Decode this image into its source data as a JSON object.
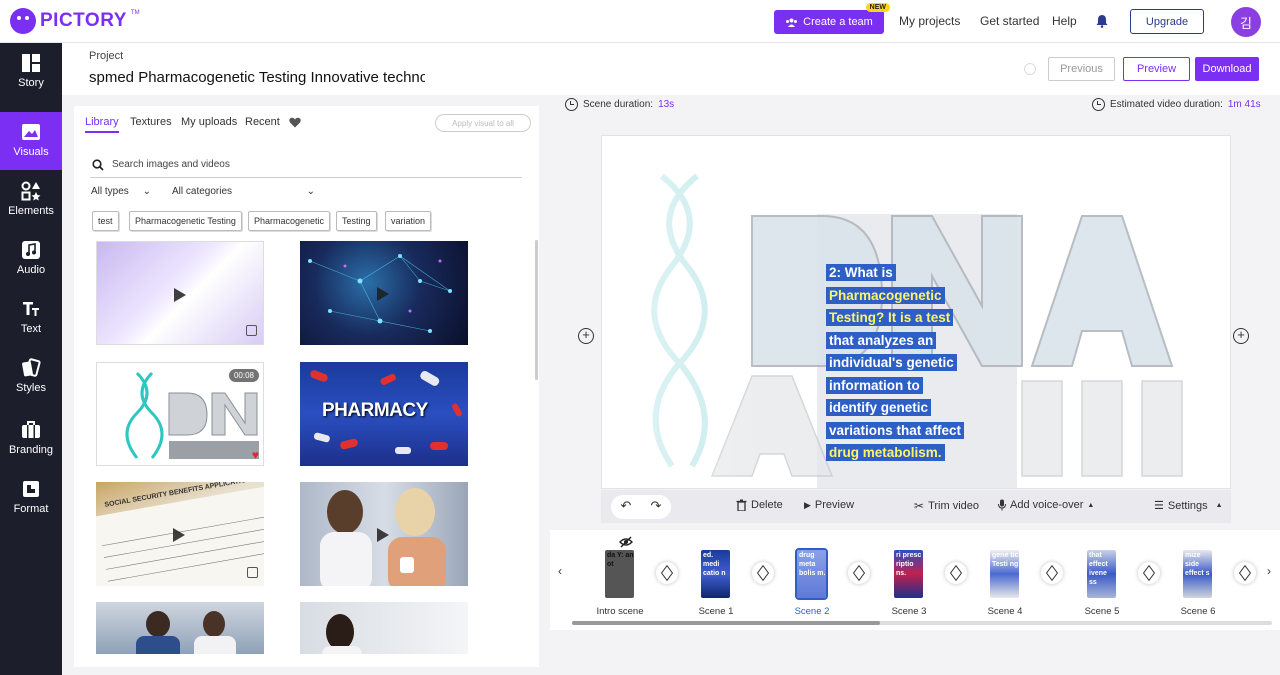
{
  "brand": {
    "name": "PICTORY",
    "tm": "TM",
    "accent": "#7b2ff2",
    "sidebar_bg": "#1d1e2c"
  },
  "header": {
    "create_team": "Create a team",
    "new_badge": "NEW",
    "nav": [
      "My projects",
      "Get started",
      "Help"
    ],
    "upgrade": "Upgrade",
    "avatar_initial": "김"
  },
  "sidebar": {
    "items": [
      {
        "label": "Story",
        "icon": "story-icon"
      },
      {
        "label": "Visuals",
        "icon": "image-icon",
        "active": true
      },
      {
        "label": "Elements",
        "icon": "elements-icon"
      },
      {
        "label": "Audio",
        "icon": "music-note-icon"
      },
      {
        "label": "Text",
        "icon": "text-icon"
      },
      {
        "label": "Styles",
        "icon": "styles-icon"
      },
      {
        "label": "Branding",
        "icon": "briefcase-icon"
      },
      {
        "label": "Format",
        "icon": "crop-icon"
      }
    ]
  },
  "project": {
    "label": "Project",
    "title": "spmed Pharmacogenetic Testing Innovative technology",
    "previous": "Previous",
    "preview": "Preview",
    "download": "Download"
  },
  "library": {
    "tabs": [
      "Library",
      "Textures",
      "My uploads",
      "Recent"
    ],
    "apply_all": "Apply visual to all",
    "search_placeholder": "Search images and videos",
    "type_filter": "All types",
    "category_filter": "All categories",
    "tags": [
      "test",
      "Pharmacogenetic Testing",
      "Pharmacogenetic",
      "Testing",
      "variation"
    ],
    "thumbnails": [
      {
        "name": "purple-light-video"
      },
      {
        "name": "network-nodes-video"
      },
      {
        "name": "dna-analysis-video",
        "duration": "00:08",
        "favorited": true
      },
      {
        "name": "pharmacy-pills-video",
        "overlay_text": "PHARMACY"
      },
      {
        "name": "social-security-form-video",
        "overlay_text": "SOCIAL SECURITY BENEFITS APPLICATION"
      },
      {
        "name": "pharmacist-women-video"
      },
      {
        "name": "pharmacy-staff-video"
      },
      {
        "name": "woman-pharmacy-video"
      }
    ]
  },
  "scene": {
    "duration_label": "Scene duration:",
    "duration_value": "13s",
    "est_label": "Estimated video duration:",
    "est_value": "1m 41s",
    "caption_lines": [
      {
        "text": "2: What is",
        "hl": false
      },
      {
        "text": "Pharmacogenetic",
        "hl": true
      },
      {
        "text": "Testing? It is a test",
        "hl": true
      },
      {
        "text": "that analyzes an",
        "hl": false
      },
      {
        "text": "individual's genetic",
        "hl": false
      },
      {
        "text": "information to",
        "hl": false
      },
      {
        "text": "identify genetic",
        "hl": false
      },
      {
        "text": "variations that affect",
        "hl": false
      },
      {
        "text": "drug metabolism.",
        "hl": true
      }
    ],
    "background_text": "DNA ANALYSIS",
    "tools": {
      "delete": "Delete",
      "preview": "Preview",
      "trim": "Trim video",
      "voice": "Add voice-over",
      "settings": "Settings"
    }
  },
  "timeline": {
    "scenes": [
      {
        "label": "Intro scene",
        "snippet": "da Y: an ot",
        "hidden": true
      },
      {
        "label": "Scene 1",
        "snippet": "ed. medi catio n"
      },
      {
        "label": "Scene 2",
        "snippet": "drug meta bolis m.",
        "active": true
      },
      {
        "label": "Scene 3",
        "snippet": "ri presc riptio ns."
      },
      {
        "label": "Scene 4",
        "snippet": "gene tic Testi ng"
      },
      {
        "label": "Scene 5",
        "snippet": "that effect ivene ss"
      },
      {
        "label": "Scene 6",
        "snippet": "mize side effect s"
      }
    ]
  }
}
